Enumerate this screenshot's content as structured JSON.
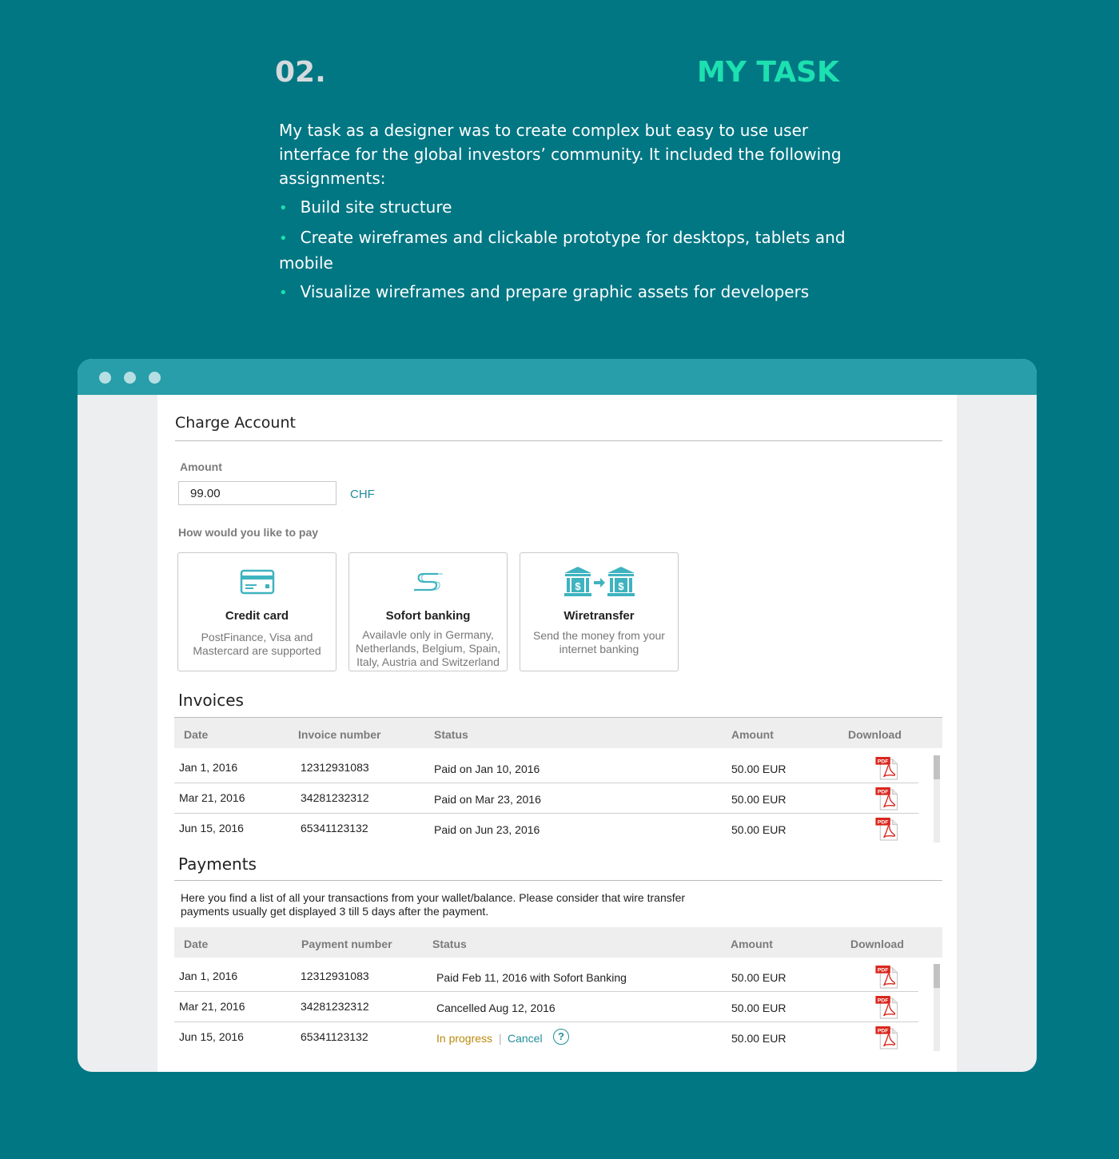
{
  "section": {
    "number": "02.",
    "title": "MY TASK",
    "intro": "My task as a designer was to create complex but easy to use user interface for the global investors’ community.  It included the following assignments:",
    "bullets": [
      "Build site structure",
      "Create wireframes and clickable prototype for desktops, tablets and mobile",
      "Visualize wireframes and prepare graphic assets for developers"
    ]
  },
  "charge": {
    "title": "Charge Account",
    "amount_label": "Amount",
    "amount_value": "99.00",
    "currency": "CHF",
    "pay_label": "How would you like to pay",
    "methods": [
      {
        "title": "Credit card",
        "desc": "PostFinance, Visa and Mastercard are supported",
        "icon": "credit-card-icon"
      },
      {
        "title": "Sofort banking",
        "desc": "Availavle only in Germany, Netherlands, Belgium, Spain, Italy, Austria and Switzerland",
        "icon": "sofort-icon"
      },
      {
        "title": "Wiretransfer",
        "desc": "Send the money from your internet banking",
        "icon": "bank-transfer-icon"
      }
    ]
  },
  "invoices": {
    "title": "Invoices",
    "columns": [
      "Date",
      "Invoice number",
      "Status",
      "Amount",
      "Download"
    ],
    "rows": [
      {
        "date": "Jan 1, 2016",
        "number": "12312931083",
        "status": "Paid on Jan 10, 2016",
        "amount": "50.00 EUR"
      },
      {
        "date": "Mar 21, 2016",
        "number": "34281232312",
        "status": "Paid on Mar 23, 2016",
        "amount": "50.00 EUR"
      },
      {
        "date": "Jun 15, 2016",
        "number": "65341123132",
        "status": "Paid on Jun 23, 2016",
        "amount": "50.00 EUR"
      }
    ]
  },
  "payments": {
    "title": "Payments",
    "description": "Here you find a list of all your transactions from your wallet/balance. Please consider that wire transfer payments usually get displayed 3 till 5 days after the payment.",
    "columns": [
      "Date",
      "Payment number",
      "Status",
      "Amount",
      "Download"
    ],
    "rows": [
      {
        "date": "Jan 1, 2016",
        "number": "12312931083",
        "status": "Paid Feb 11, 2016 with Sofort Banking",
        "amount": "50.00 EUR"
      },
      {
        "date": "Mar 21, 2016",
        "number": "34281232312",
        "status": "Cancelled Aug 12, 2016",
        "amount": "50.00 EUR"
      },
      {
        "date": "Jun 15, 2016",
        "number": "65341123132",
        "status_progress": "In progress",
        "status_sep": "|",
        "status_cancel": "Cancel",
        "help": "?",
        "amount": "50.00 EUR"
      }
    ]
  },
  "pdf_label": "PDF",
  "colors": {
    "background": "#027784",
    "accent": "#1de0b0",
    "titlebar": "#279ea9",
    "link": "#1f8f99",
    "in_progress": "#b98a0c",
    "pdf_red": "#d9261c"
  }
}
